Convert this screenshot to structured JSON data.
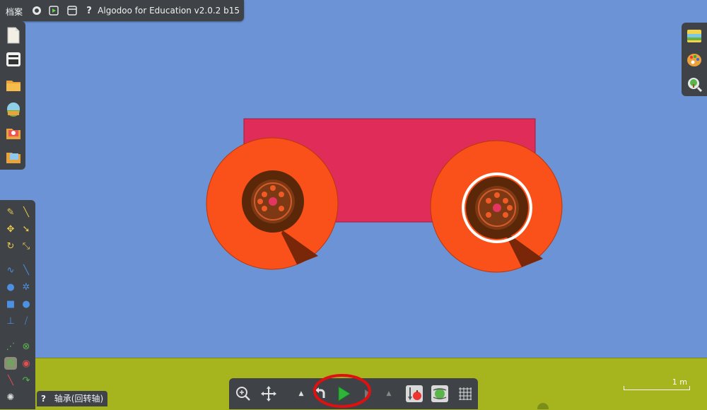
{
  "menu": {
    "file_label": "档案"
  },
  "app": {
    "title": "Algodoo for Education v2.0.2 b15"
  },
  "top_icons": [
    "gear-icon",
    "play-square-icon",
    "window-icon",
    "help-icon"
  ],
  "top_help": "?",
  "file_tools": [
    "new-scene-icon",
    "scene-window-icon",
    "open-folder-icon",
    "phunlet-icon",
    "scene-gallery-icon",
    "save-folder-icon"
  ],
  "tools_left": [
    "sketch-tool",
    "drag-tool",
    "move-tool",
    "cut-tool",
    "rotate-tool",
    "scale-tool",
    "rope-tool",
    "knife-tool",
    "brush-tool",
    "gear-tool",
    "box-tool",
    "circle-tool",
    "plane-tool",
    "chain-tool",
    "spring-tool",
    "fixate-tool",
    "hinge-tool",
    "thruster-tool",
    "tracer-tool",
    "laser-tool",
    "chaos-tool"
  ],
  "tooltip": {
    "icon": "?",
    "text": "轴承(回转轴)"
  },
  "right_tools": [
    "visualization-icon",
    "material-palette-icon",
    "zoom-tree-icon"
  ],
  "sim_controls": [
    "zoom-icon",
    "pan-icon",
    "speed-up-arrow-icon",
    "undo-icon",
    "play-button",
    "redo-icon",
    "speed-down-arrow-icon",
    "gravity-icon",
    "air-icon",
    "grid-icon"
  ],
  "scale_bar": {
    "label": "1 m"
  },
  "colors": {
    "sky": "#6b93d6",
    "ground": "#a6b41e",
    "body": "#e02c58",
    "wheel": "#fa5019",
    "hub": "#5a2708",
    "highlight": "#e01010",
    "panel": "#3f4347"
  }
}
